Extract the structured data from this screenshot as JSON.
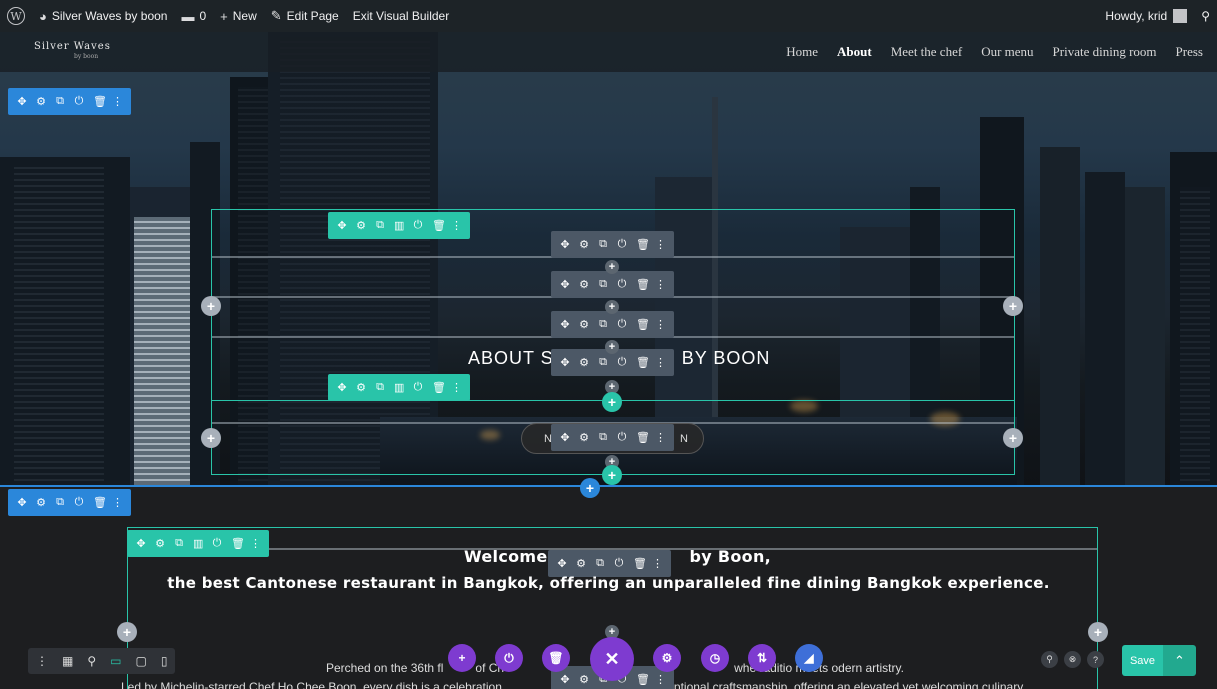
{
  "admin_bar": {
    "wp_logo": "W",
    "site_name": "Silver Waves by boon",
    "comments_count": "0",
    "new_label": "New",
    "edit_page_label": "Edit Page",
    "exit_builder_label": "Exit Visual Builder",
    "howdy": "Howdy, krid"
  },
  "site": {
    "logo_main": "Silver Waves",
    "logo_sub": "by boon",
    "nav": [
      "Home",
      "About",
      "Meet the chef",
      "Our menu",
      "Private dining room",
      "Press"
    ],
    "active_nav": "About"
  },
  "toolbar_icons": {
    "move": "✥",
    "settings": "⚙",
    "duplicate": "⧉",
    "columns": "▥",
    "power": "⏻",
    "delete": "🗑",
    "more": "⋮",
    "plus": "+"
  },
  "hero": {
    "title_left": "ABOUT S",
    "title_right": "BY BOON",
    "button_left": "N",
    "button_right": "N"
  },
  "intro": {
    "welcome_left": "Welcome",
    "welcome_right": "by Boon,",
    "subheading": "the best Cantonese restaurant in Bangkok, offering an unparalleled fine dining Bangkok experience.",
    "para1_left": "Perched on the 36th fl",
    "para1_mid": "of Ch",
    "para1_right": "whe    raditio    meets    odern artistry.",
    "para2_left": "Led by Michelin-starred Chef Ho Chee Boon, every dish is a celebration",
    "para2_right": "nd exceptional craftsmanship, offering an elevated yet welcoming culinary"
  },
  "builder": {
    "save_label": "Save",
    "close_symbol": "✕"
  },
  "colors": {
    "section_blue": "#2b87da",
    "row_green": "#29c4a9",
    "module_grey": "#4c5866",
    "builder_purple": "#7e3bd0"
  }
}
